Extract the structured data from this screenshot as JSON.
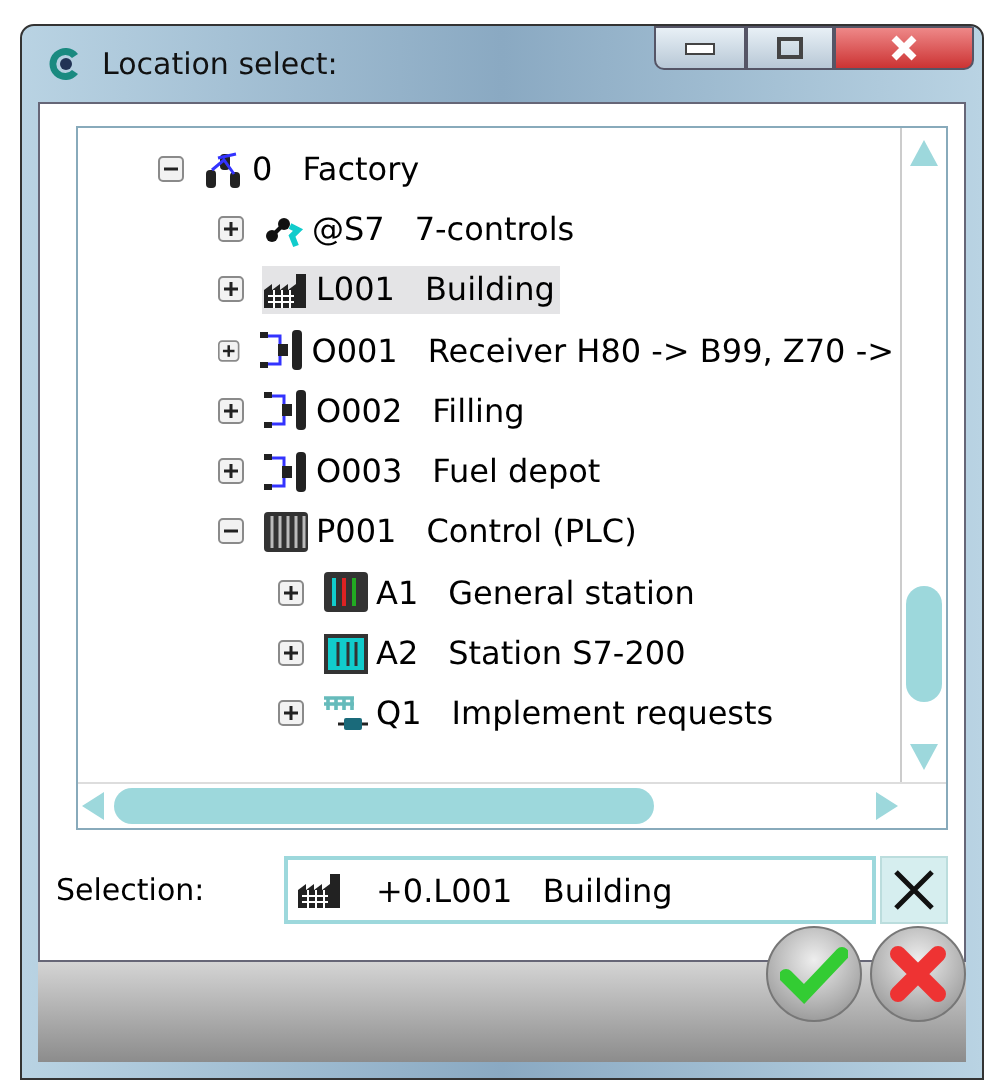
{
  "window": {
    "title": "Location select:"
  },
  "tree": [
    {
      "kind": "plant",
      "code": "0",
      "label": "Factory",
      "expanded": true,
      "selected": false,
      "children": [
        {
          "kind": "network",
          "code": "@S7",
          "label": "7-controls",
          "expanded": false,
          "selected": false
        },
        {
          "kind": "building",
          "code": "L001",
          "label": "Building",
          "expanded": false,
          "selected": true
        },
        {
          "kind": "process",
          "code": "O001",
          "label": "Receiver H80 -> B99, Z70 ->",
          "expanded": false,
          "selected": false
        },
        {
          "kind": "process",
          "code": "O002",
          "label": "Filling",
          "expanded": false,
          "selected": false
        },
        {
          "kind": "process",
          "code": "O003",
          "label": "Fuel depot",
          "expanded": false,
          "selected": false
        },
        {
          "kind": "rack",
          "code": "P001",
          "label": "Control (PLC)",
          "expanded": true,
          "selected": false,
          "children": [
            {
              "kind": "station",
              "code": "A1",
              "label": "General station",
              "expanded": false,
              "selected": false
            },
            {
              "kind": "station2",
              "code": "A2",
              "label": "Station S7-200",
              "expanded": false,
              "selected": false
            },
            {
              "kind": "request",
              "code": "Q1",
              "label": "Implement requests",
              "expanded": false,
              "selected": false
            }
          ]
        }
      ]
    }
  ],
  "selection": {
    "label": "Selection:",
    "value": "+0.L001   Building"
  }
}
